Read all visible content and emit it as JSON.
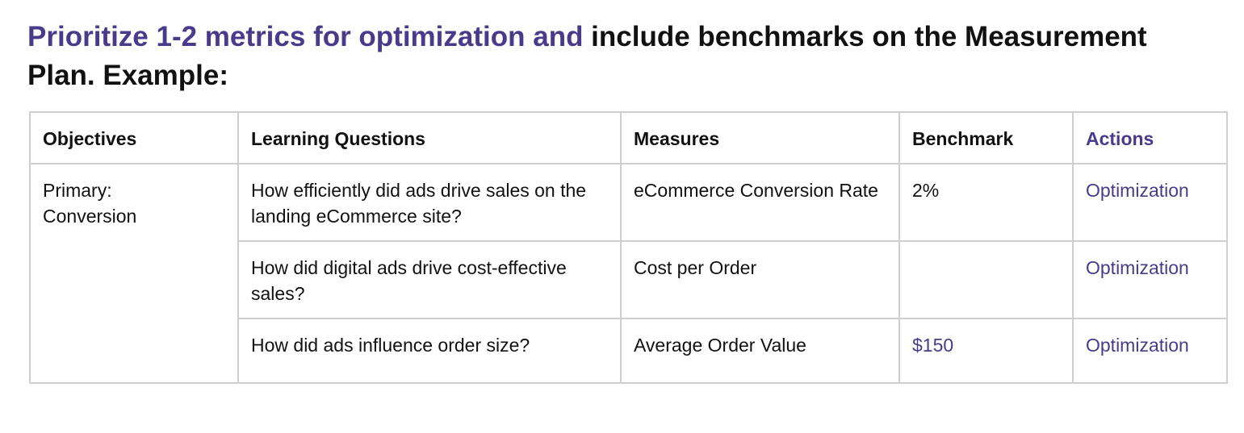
{
  "heading": {
    "accent_text": "Prioritize 1-2 metrics for optimization and",
    "rest_text": " include benchmarks on the Measurement Plan. Example:"
  },
  "table": {
    "headers": [
      "Objectives",
      "Learning Questions",
      "Measures",
      "Benchmark",
      "Actions"
    ],
    "objective_line1": "Primary:",
    "objective_line2": "Conversion",
    "rows": [
      {
        "question": "How efficiently did ads drive sales on the landing eCommerce site?",
        "measure": "eCommerce Conversion Rate",
        "benchmark": "2%",
        "action": "Optimization"
      },
      {
        "question": "How did digital ads drive cost-effective sales?",
        "measure": "Cost per Order",
        "benchmark": "",
        "action": "Optimization"
      },
      {
        "question": "How did ads influence order size?",
        "measure": "Average Order Value",
        "benchmark": "$150",
        "action": "Optimization"
      }
    ]
  },
  "colors": {
    "accent": "#4a3a8c",
    "text": "#111111",
    "border": "#cfcfcf"
  }
}
